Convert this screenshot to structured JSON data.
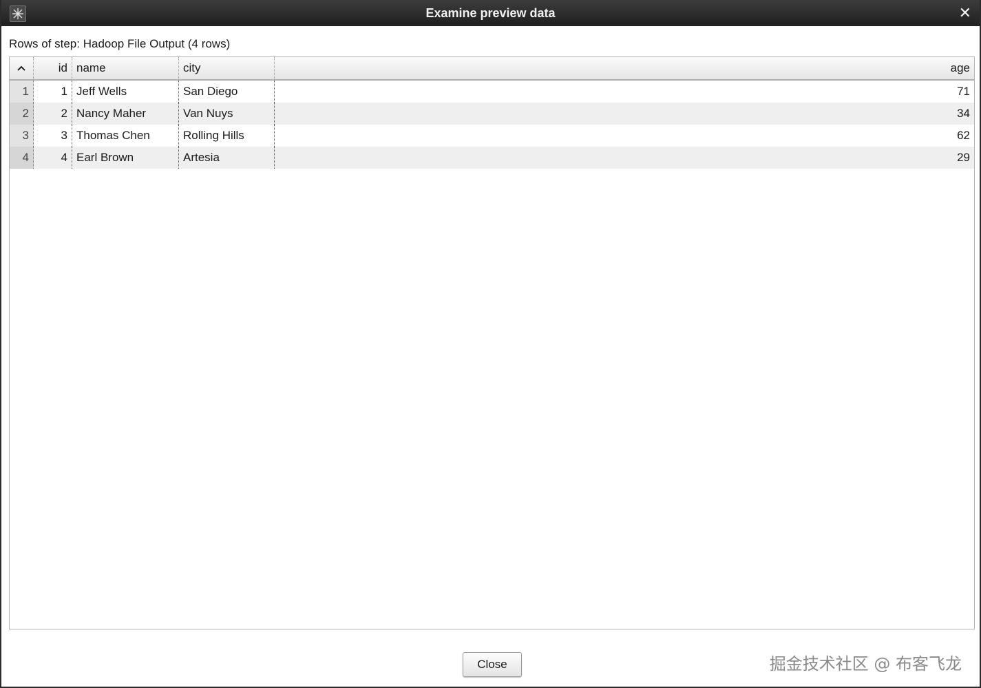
{
  "window": {
    "title": "Examine preview data"
  },
  "step_label": "Rows of step: Hadoop File Output (4 rows)",
  "table": {
    "columns": [
      "id",
      "name",
      "city",
      "age"
    ],
    "rows": [
      {
        "num": "1",
        "id": "1",
        "name": "Jeff Wells",
        "city": "San Diego",
        "age": "71"
      },
      {
        "num": "2",
        "id": "2",
        "name": "Nancy Maher",
        "city": "Van Nuys",
        "age": "34"
      },
      {
        "num": "3",
        "id": "3",
        "name": "Thomas Chen",
        "city": "Rolling Hills",
        "age": "62"
      },
      {
        "num": "4",
        "id": "4",
        "name": "Earl Brown",
        "city": "Artesia",
        "age": "29"
      }
    ]
  },
  "buttons": {
    "close_label": "Close"
  },
  "watermark": "掘金技术社区 @ 布客飞龙",
  "icons": {
    "app": "app-icon",
    "close": "close-icon",
    "sort": "sort-up-icon"
  }
}
